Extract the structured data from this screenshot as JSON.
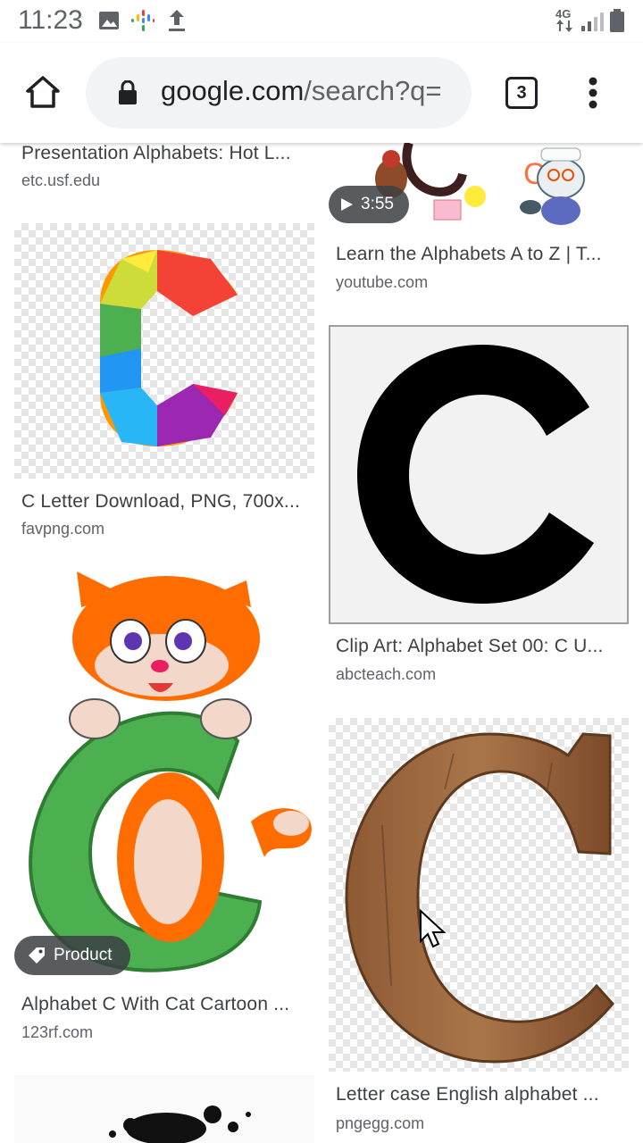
{
  "status_bar": {
    "time": "11:23",
    "network": "4G"
  },
  "browser": {
    "url_host": "google.com",
    "url_rest": "/search?q=",
    "tab_count": "3"
  },
  "results": {
    "left": [
      {
        "title": "Presentation Alphabets: Hot L...",
        "source": "etc.usf.edu"
      },
      {
        "title": "C Letter Download, PNG, 700x...",
        "source": "favpng.com"
      },
      {
        "title": "Alphabet C With Cat Cartoon ...",
        "source": "123rf.com",
        "badge": "Product"
      }
    ],
    "right": [
      {
        "title": "Learn the Alphabets A to Z | T...",
        "source": "youtube.com",
        "duration": "3:55"
      },
      {
        "title": "Clip Art: Alphabet Set 00: C U...",
        "source": "abcteach.com"
      },
      {
        "title": "Letter case English alphabet ...",
        "source": "pngegg.com"
      }
    ]
  }
}
